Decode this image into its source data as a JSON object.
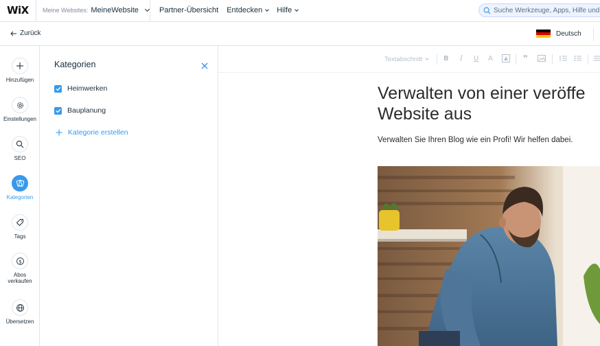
{
  "topbar": {
    "logo": "WiX",
    "site_select": {
      "label": "Meine Websites:",
      "value": "MeineWebsite"
    },
    "nav": [
      {
        "label": "Partner-Übersicht",
        "has_menu": false
      },
      {
        "label": "Entdecken",
        "has_menu": true
      },
      {
        "label": "Hilfe",
        "has_menu": true
      }
    ],
    "search": {
      "placeholder": "Suche Werkzeuge, Apps, Hilfe und m"
    }
  },
  "subbar": {
    "back_label": "Zurück",
    "language": "Deutsch",
    "flag_colors": [
      "#000000",
      "#dd0000",
      "#ffce00"
    ]
  },
  "rail": {
    "items": [
      {
        "label": "Hinzufügen",
        "icon": "plus-icon",
        "active": false
      },
      {
        "label": "Einstellungen",
        "icon": "gear-icon",
        "active": false
      },
      {
        "label": "SEO",
        "icon": "search-icon",
        "active": false
      },
      {
        "label": "Kategorien",
        "icon": "categories-icon",
        "active": true
      },
      {
        "label": "Tags",
        "icon": "tag-icon",
        "active": false
      },
      {
        "label": "Abos verkaufen",
        "icon": "dollar-icon",
        "active": false
      },
      {
        "label": "Übersetzen",
        "icon": "globe-icon",
        "active": false
      }
    ]
  },
  "panel": {
    "title": "Kategorien",
    "categories": [
      {
        "label": "Heimwerken",
        "checked": true
      },
      {
        "label": "Bauplanung",
        "checked": true
      }
    ],
    "create_label": "Kategorie erstellen"
  },
  "editor": {
    "toolbar": {
      "text_style": "Textabschnitt",
      "buttons": [
        "bold-icon",
        "italic-icon",
        "underline-icon",
        "text-color-icon",
        "highlight-icon",
        "quote-icon",
        "image-icon",
        "numbered-list-icon",
        "bullet-list-icon",
        "align-icon"
      ]
    },
    "heading_lines": [
      "Verwalten von einer veröffe",
      "Website aus"
    ],
    "subtext": "Verwalten Sie Ihren Blog wie ein Profi! Wir helfen dabei."
  },
  "colors": {
    "accent": "#3899ec",
    "border": "#dfe5eb",
    "text": "#20303c"
  }
}
